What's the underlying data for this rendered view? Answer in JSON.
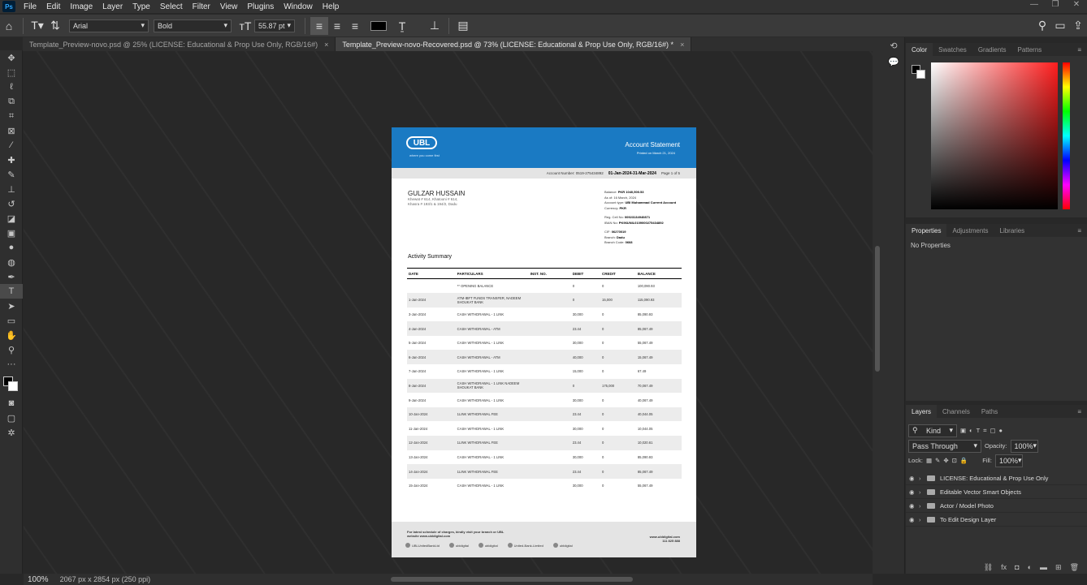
{
  "menubar": {
    "items": [
      "File",
      "Edit",
      "Image",
      "Layer",
      "Type",
      "Select",
      "Filter",
      "View",
      "Plugins",
      "Window",
      "Help"
    ]
  },
  "options": {
    "font_family": "Arial",
    "font_style": "Bold",
    "font_size": "55.87 pt"
  },
  "tabs": [
    {
      "label": "Template_Preview-novo.psd @ 25% (LICENSE: Educational & Prop Use Only, RGB/16#)"
    },
    {
      "label": "Template_Preview-novo-Recovered.psd @ 73% (LICENSE: Educational & Prop Use Only, RGB/16#) *"
    }
  ],
  "status": {
    "zoom": "100%",
    "size": "2067 px x 2854 px (250 ppi)"
  },
  "doc": {
    "logo": "UBL",
    "tagline": "where you come first",
    "title": "Account Statement",
    "printed": "Printed on March 21, 2024",
    "acct_label": "Account Number: 0519-275434892",
    "period": "01-Jan-2024-31-Mar-2024",
    "page": "Page 1 of 5",
    "name": "GULZAR HUSSAIN",
    "address": "Khewat # 614, Khatooni # 614, Khasra # 193/1 & 194/2, Dadu",
    "info": [
      {
        "k": "Balance:",
        "v": "PKR 1040,500.53"
      },
      {
        "k": "As of:",
        "v": "16 March, 2024"
      },
      {
        "k": "Account type:",
        "v": "UBl Muhammad Current Account"
      },
      {
        "k": "Currency:",
        "v": "PKR"
      },
      {
        "k": "Reg. Cell No:",
        "v": "00923134940871"
      },
      {
        "k": "IBAN No:",
        "v": "PK96UNIL0109000275434892"
      },
      {
        "k": "CIF:",
        "v": "06270019"
      },
      {
        "k": "Branch:",
        "v": "Dadu"
      },
      {
        "k": "Branch Code:",
        "v": "0668"
      }
    ],
    "activity": "Activity Summary",
    "columns": [
      "DATE",
      "PARTICULARS",
      "INST. NO.",
      "DEBIT",
      "CREDIT",
      "BALANCE"
    ],
    "rows": [
      [
        "",
        "** OPENING BALANCE",
        "",
        "0",
        "0",
        "100,090.93"
      ],
      [
        "1-Jan-2024",
        "ATM-IBFT FUNDS TRANSFER, NADEEM SHOUKAT BANK",
        "",
        "0",
        "15,000",
        "115,090.93"
      ],
      [
        "3-Jan-2024",
        "CASH WITHDRAWAL - 1 LINK",
        "",
        "30,000",
        "0",
        "85,090.93"
      ],
      [
        "4-Jan-2024",
        "CASH WITHDRAWAL - ATM",
        "",
        "23.44",
        "0",
        "85,067.49"
      ],
      [
        "5-Jan-2024",
        "CASH WITHDRAWAL - 1 LINK",
        "",
        "30,000",
        "0",
        "55,067.49"
      ],
      [
        "6-Jan-2024",
        "CASH WITHDRAWAL - ATM",
        "",
        "40,000",
        "0",
        "15,067.49"
      ],
      [
        "7-Jan-2024",
        "CASH WITHDRAWAL - 1 LINK",
        "",
        "15,000",
        "0",
        "67.49"
      ],
      [
        "8-Jan-2024",
        "CASH WITHDRAWAL - 1 LINK NADEEM SHOUKAT BANK",
        "",
        "0",
        "175,000",
        "70,067.49"
      ],
      [
        "9-Jan-2024",
        "CASH WITHDRAWAL - 1 LINK",
        "",
        "30,000",
        "0",
        "40,067.49"
      ],
      [
        "10-Jan-2024",
        "1LINK WITHDRAWAL FEE",
        "",
        "23.44",
        "0",
        "40,044.05"
      ],
      [
        "11-Jan-2024",
        "CASH WITHDRAWAL - 1 LINK",
        "",
        "30,000",
        "0",
        "10,044.05"
      ],
      [
        "12-Jan-2024",
        "1LINK WITHDRAWAL FEE",
        "",
        "23.44",
        "0",
        "10,020.61"
      ],
      [
        "13-Jan-2024",
        "CASH WITHDRAWAL - 1 LINK",
        "",
        "30,000",
        "0",
        "85,090.93"
      ],
      [
        "14-Jan-2024",
        "1LINK WITHDRAWAL FEE",
        "",
        "23.44",
        "0",
        "85,067.49"
      ],
      [
        "15-Jan-2024",
        "CASH WITHDRAWAL - 1 LINK",
        "",
        "30,000",
        "0",
        "55,067.49"
      ]
    ],
    "footer_note": "For latest schedule of charges, kindly visit your branch or UBL website www.ubldigital.com",
    "footer_site": "www.ubldigital.com",
    "footer_phone": "111 825 888",
    "social": [
      "UBLUnitedBankLtd",
      "ubldigital",
      "ubldigital",
      "United-Bank-Limited",
      "ubldigital"
    ]
  },
  "panels": {
    "color_tabs": [
      "Color",
      "Swatches",
      "Gradients",
      "Patterns"
    ],
    "prop_tabs": [
      "Properties",
      "Adjustments",
      "Libraries"
    ],
    "no_props": "No Properties",
    "layer_tabs": [
      "Layers",
      "Channels",
      "Paths"
    ],
    "kind": "Kind",
    "blend": "Pass Through",
    "opacity_label": "Opacity:",
    "opacity": "100%",
    "lock_label": "Lock:",
    "fill_label": "Fill:",
    "fill": "100%",
    "layers": [
      "LICENSE: Educational & Prop Use Only",
      "Editable Vector Smart Objects",
      "Actor / Model Photo",
      "To Edit Design Layer"
    ]
  }
}
